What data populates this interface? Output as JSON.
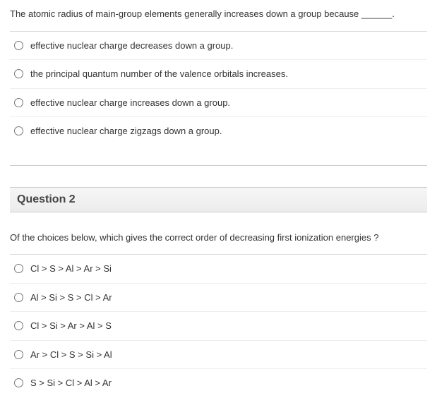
{
  "q1": {
    "prompt": "The atomic radius of main-group elements generally increases down a group because ______.",
    "options": [
      "effective nuclear charge decreases down a group.",
      "the principal quantum number of the valence orbitals increases.",
      "effective nuclear charge increases down a group.",
      "effective nuclear charge zigzags down a group."
    ]
  },
  "q2": {
    "heading": "Question 2",
    "prompt": "Of the choices below, which gives the correct order of decreasing first ionization energies ?",
    "options": [
      "Cl > S > Al > Ar > Si",
      "Al > Si > S > Cl > Ar",
      "Cl > Si > Ar > Al > S",
      "Ar > Cl > S > Si > Al",
      "S > Si > Cl > Al > Ar"
    ]
  }
}
